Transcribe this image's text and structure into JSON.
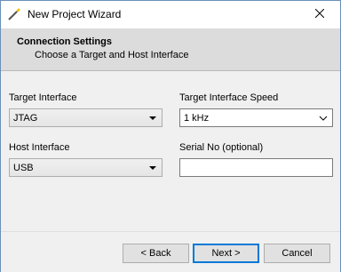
{
  "window": {
    "title": "New Project Wizard"
  },
  "icons": {
    "app": "wand-icon",
    "close": "close-icon"
  },
  "header": {
    "title": "Connection Settings",
    "subtitle": "Choose a Target and Host Interface"
  },
  "fields": {
    "target_interface": {
      "label": "Target Interface",
      "value": "JTAG"
    },
    "target_interface_speed": {
      "label": "Target Interface Speed",
      "value": "1 kHz"
    },
    "host_interface": {
      "label": "Host Interface",
      "value": "USB"
    },
    "serial_no": {
      "label": "Serial No (optional)",
      "value": ""
    }
  },
  "buttons": {
    "back": "< Back",
    "next": "Next >",
    "cancel": "Cancel"
  },
  "colors": {
    "header_bg": "#dcdcdc",
    "accent": "#0078d7"
  }
}
